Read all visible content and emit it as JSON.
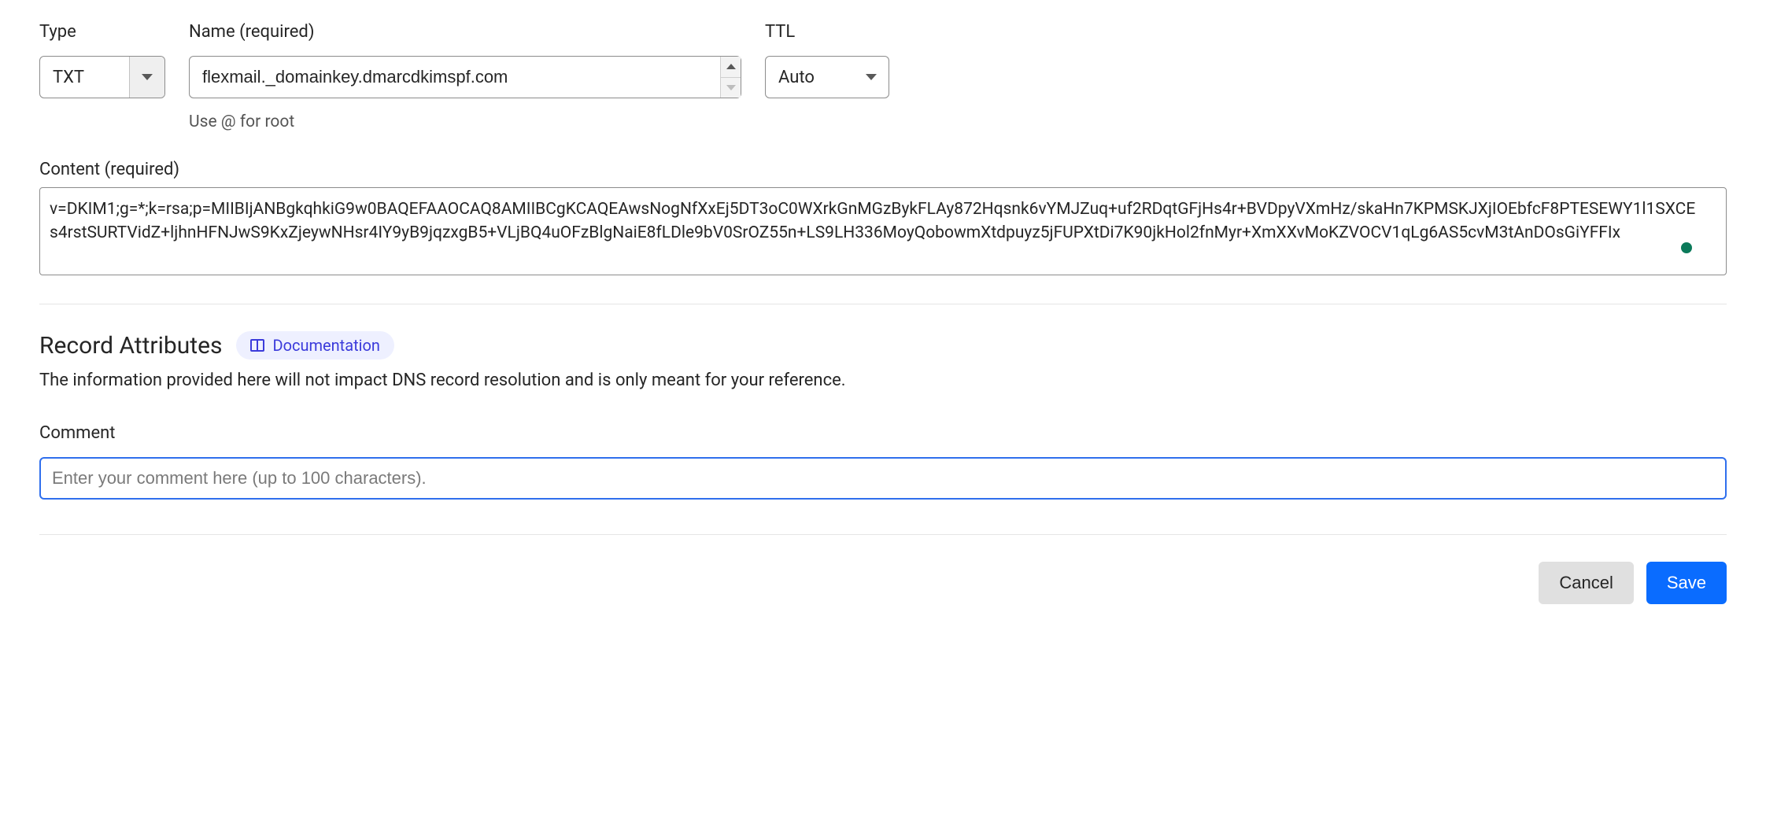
{
  "type_field": {
    "label": "Type",
    "value": "TXT"
  },
  "name_field": {
    "label": "Name (required)",
    "value": "flexmail._domainkey.dmarcdkimspf.com",
    "hint": "Use @ for root"
  },
  "ttl_field": {
    "label": "TTL",
    "value": "Auto"
  },
  "content_field": {
    "label": "Content (required)",
    "value": "v=DKIM1;g=*;k=rsa;p=MIIBIjANBgkqhkiG9w0BAQEFAAOCAQ8AMIIBCgKCAQEAwsNogNfXxEj5DT3oC0WXrkGnMGzBykFLAy872Hqsnk6vYMJZuq+uf2RDqtGFjHs4r+BVDpyVXmHz/skaHn7KPMSKJXjIOEbfcF8PTESEWY1l1SXCEs4rstSURTVidZ+ljhnHFNJwS9KxZjeywNHsr4IY9yB9jqzxgB5+VLjBQ4uOFzBlgNaiE8fLDle9bV0SrOZ55n+LS9LH336MoyQobowmXtdpuyz5jFUPXtDi7K90jkHol2fnMyr+XmXXvMoKZVOCV1qLg6AS5cvM3tAnDOsGiYFFIx"
  },
  "attributes": {
    "title": "Record Attributes",
    "doc_label": "Documentation",
    "description": "The information provided here will not impact DNS record resolution and is only meant for your reference."
  },
  "comment_field": {
    "label": "Comment",
    "placeholder": "Enter your comment here (up to 100 characters).",
    "value": ""
  },
  "buttons": {
    "cancel": "Cancel",
    "save": "Save"
  }
}
